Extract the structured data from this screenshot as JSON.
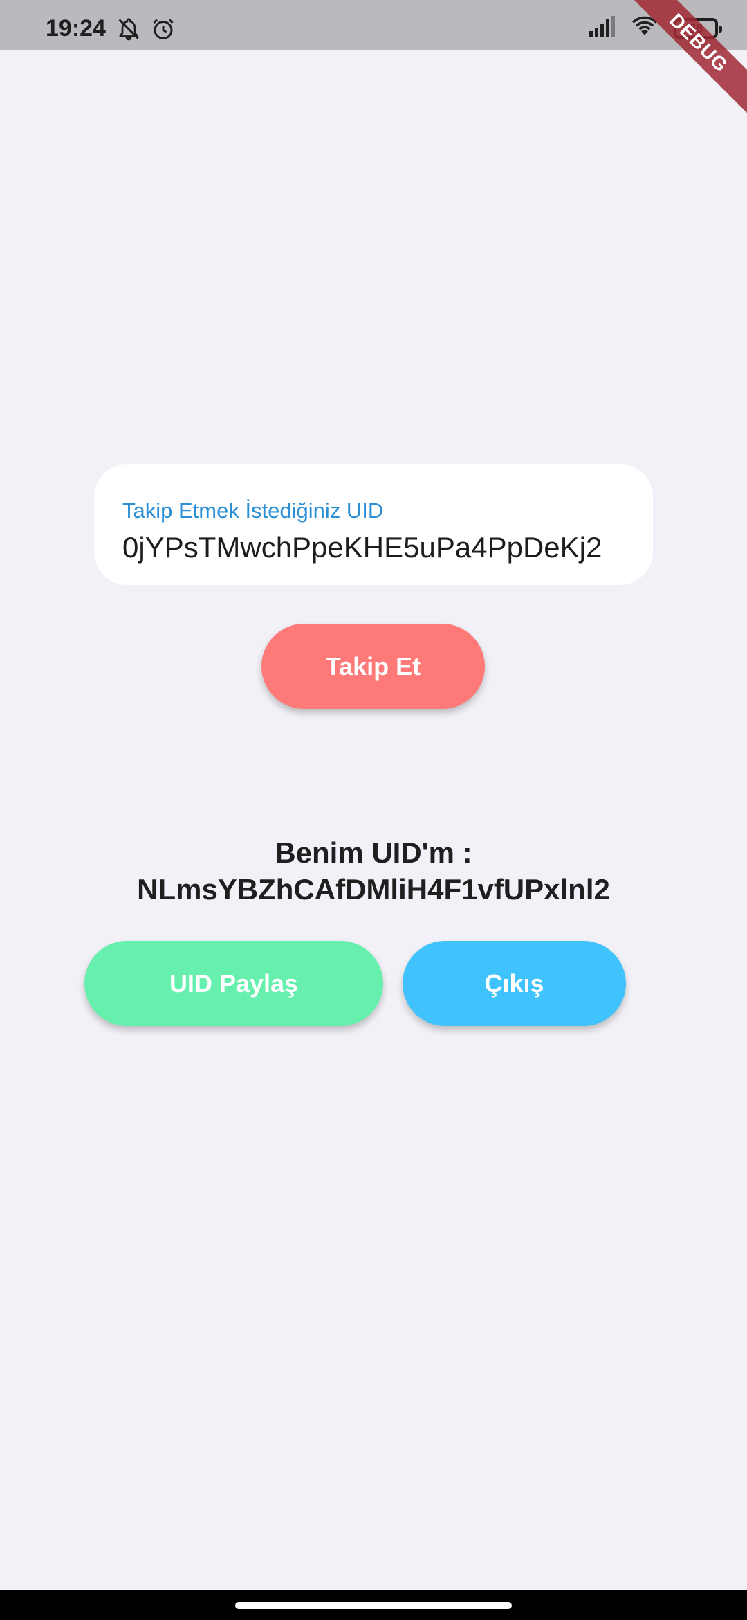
{
  "status_bar": {
    "time": "19:24",
    "battery": "38",
    "icons": [
      "notifications-off-icon",
      "alarm-icon",
      "signal-icon",
      "wifi-icon",
      "battery-icon"
    ]
  },
  "debug_banner": "DEBUG",
  "follow_input": {
    "label": "Takip Etmek İstediğiniz UID",
    "value": "0jYPsTMwchPpeKHE5uPa4PpDeKj2"
  },
  "follow_button": {
    "label": "Takip Et",
    "color": "#fe7a79"
  },
  "my_uid": {
    "label": "Benim UID'm :",
    "value": "NLmsYBZhCAfDMliH4F1vfUPxlnl2"
  },
  "share_button": {
    "label": "UID Paylaş",
    "color": "#67f0ad"
  },
  "exit_button": {
    "label": "Çıkış",
    "color": "#40c3fd"
  },
  "colors": {
    "background": "#f1f1f7",
    "label_accent": "#2b8fd6"
  }
}
